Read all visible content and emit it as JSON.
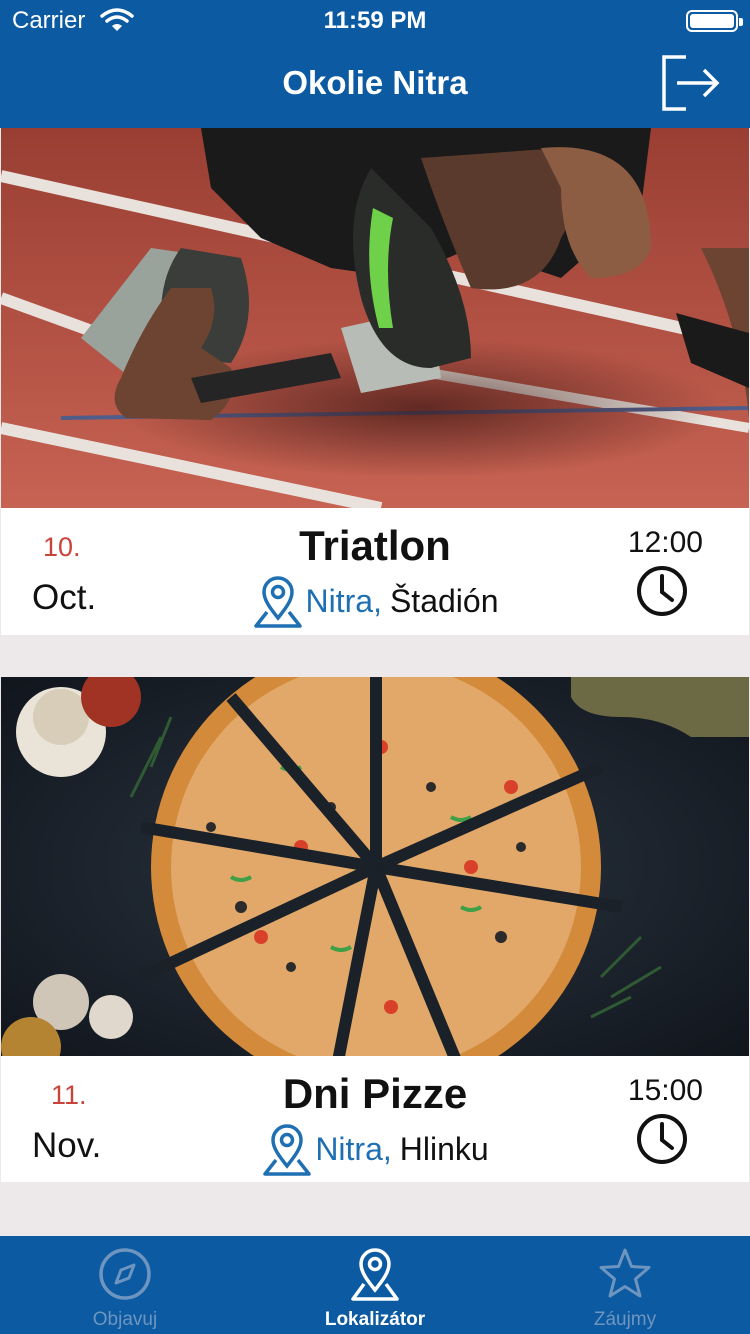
{
  "status_bar": {
    "carrier": "Carrier",
    "time": "11:59 PM"
  },
  "header": {
    "title": "Okolie Nitra",
    "logout_icon": "logout-icon"
  },
  "events": [
    {
      "day": "10.",
      "month": "Oct.",
      "title": "Triatlon",
      "city": "Nitra,",
      "place": "Štadión",
      "time": "12:00",
      "image": "running-track-athlete-photo"
    },
    {
      "day": "11.",
      "month": "Nov.",
      "title": "Dni Pizze",
      "city": "Nitra,",
      "place": "Hlinku",
      "time": "15:00",
      "image": "sliced-pizza-photo"
    }
  ],
  "tabs": [
    {
      "label": "Objavuj",
      "icon": "compass-icon",
      "active": false
    },
    {
      "label": "Lokalizátor",
      "icon": "location-pin-icon",
      "active": true
    },
    {
      "label": "Záujmy",
      "icon": "star-icon",
      "active": false
    }
  ],
  "colors": {
    "primary": "#0b5aa2",
    "date_accent": "#c8443a",
    "city_accent": "#1f6fb3",
    "feed_background": "#ede9ea",
    "inactive_tab": "#6e95bf"
  }
}
